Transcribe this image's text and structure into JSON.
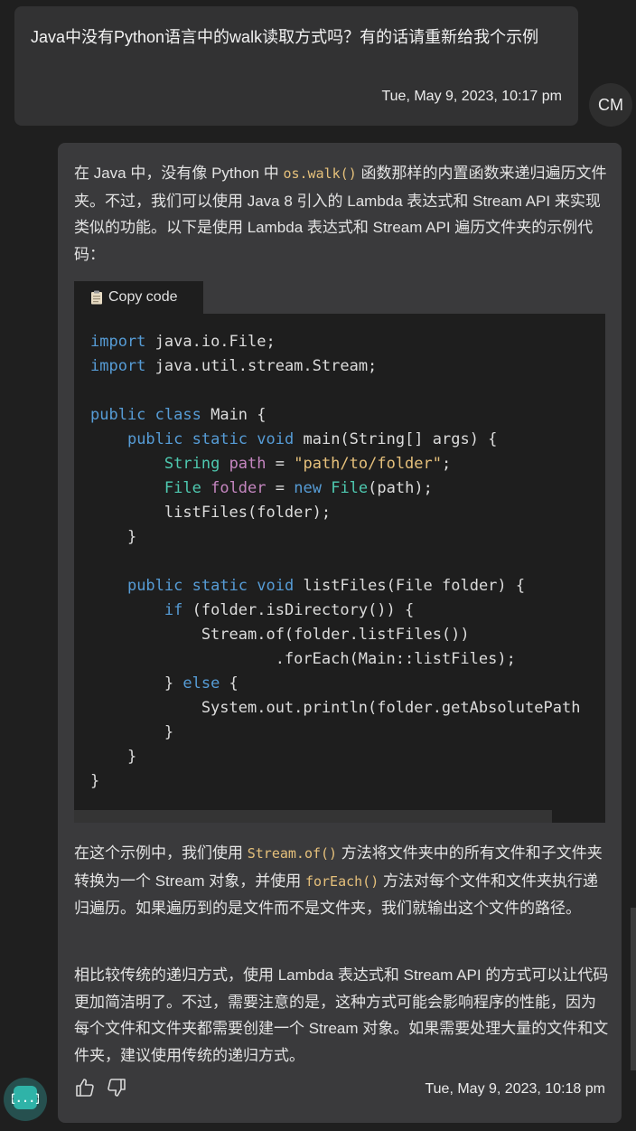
{
  "user_message": {
    "text": "Java中没有Python语言中的walk读取方式吗？有的话请重新给我个示例",
    "timestamp": "Tue, May 9, 2023, 10:17 pm",
    "avatar_initials": "CM"
  },
  "bot_message": {
    "intro": {
      "before": "在 Java 中，没有像 Python 中 ",
      "code": "os.walk()",
      "after": " 函数那样的内置函数来递归遍历文件夹。不过，我们可以使用 Java 8 引入的 Lambda 表达式和 Stream API 来实现类似的功能。以下是使用 Lambda 表达式和 Stream API 遍历文件夹的示例代码："
    },
    "copy_label": "Copy code",
    "code_lines": [
      "import java.io.File;",
      "import java.util.stream.Stream;",
      "",
      "public class Main {",
      "    public static void main(String[] args) {",
      "        String path = \"path/to/folder\";",
      "        File folder = new File(path);",
      "        listFiles(folder);",
      "    }",
      "",
      "    public static void listFiles(File folder) {",
      "        if (folder.isDirectory()) {",
      "            Stream.of(folder.listFiles())",
      "                    .forEach(Main::listFiles);",
      "        } else {",
      "            System.out.println(folder.getAbsolutePath",
      "        }",
      "    }",
      "}"
    ],
    "explanation": {
      "p1": "在这个示例中，我们使用 ",
      "c1": "Stream.of()",
      "p2": " 方法将文件夹中的所有文件和子文件夹转换为一个 Stream 对象，并使用 ",
      "c2": "forEach()",
      "p3": " 方法对每个文件和文件夹执行递归遍历。如果遍历到的是文件而不是文件夹，我们就输出这个文件的路径。"
    },
    "conclusion": "相比较传统的递归方式，使用 Lambda 表达式和 Stream API 的方式可以让代码更加简洁明了。不过，需要注意的是，这种方式可能会影响程序的性能，因为每个文件和文件夹都需要创建一个 Stream 对象。如果需要处理大量的文件和文件夹，建议使用传统的递归方式。",
    "timestamp": "Tue, May 9, 2023, 10:18 pm"
  },
  "icons": {
    "copy": "clipboard-icon",
    "like": "thumbs-up-icon",
    "dislike": "thumbs-down-icon",
    "bot_avatar": "braces-icon"
  },
  "colors": {
    "page_bg": "#1f1f1f",
    "user_bubble": "#323233",
    "bot_bubble": "#3a3a3c",
    "code_bg": "#1e1e1e",
    "inline_code": "#e5c07b",
    "keyword": "#569cd6",
    "type": "#4ec9b0",
    "variable": "#c586c0",
    "bot_avatar_bg": "#26504f",
    "bot_avatar_fg": "#4fd1c5"
  }
}
